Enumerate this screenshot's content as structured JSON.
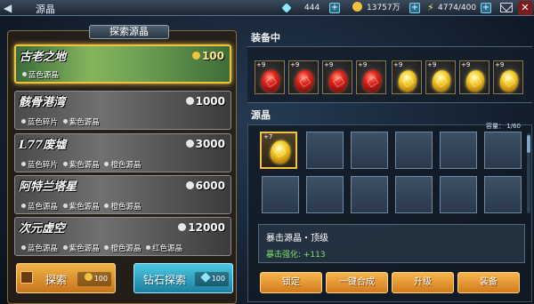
{
  "topbar": {
    "title": "源晶",
    "diamonds": "444",
    "gold": "13757万",
    "energy": "4774/400",
    "back_icon": "arrow-left-icon",
    "mail_icon": "mail-icon",
    "close_icon": "close-icon"
  },
  "explore": {
    "header": "探索源晶",
    "areas": [
      {
        "name": "古老之地",
        "cost": "100",
        "drops": [
          "蓝色源晶"
        ],
        "active": true
      },
      {
        "name": "骸骨港湾",
        "cost": "1000",
        "drops": [
          "蓝色碎片",
          "紫色源晶"
        ],
        "active": false
      },
      {
        "name": "L77废墟",
        "cost": "3000",
        "drops": [
          "蓝色碎片",
          "紫色源晶",
          "橙色源晶"
        ],
        "active": false
      },
      {
        "name": "阿特兰塔星",
        "cost": "6000",
        "drops": [
          "蓝色源晶",
          "紫色源晶",
          "橙色源晶"
        ],
        "active": false
      },
      {
        "name": "次元虚空",
        "cost": "12000",
        "drops": [
          "蓝色源晶",
          "紫色源晶",
          "橙色源晶",
          "红色源晶"
        ],
        "active": false
      }
    ],
    "explore_button": {
      "label": "探索",
      "cost": "100"
    },
    "diamond_button": {
      "label": "钻石探索",
      "cost": "100"
    }
  },
  "equipped": {
    "title": "装备中",
    "slots": [
      {
        "level": "+9",
        "color": "red"
      },
      {
        "level": "+9",
        "color": "red"
      },
      {
        "level": "+9",
        "color": "red"
      },
      {
        "level": "+9",
        "color": "red"
      },
      {
        "level": "+9",
        "color": "gold"
      },
      {
        "level": "+9",
        "color": "gold"
      },
      {
        "level": "+9",
        "color": "gold"
      },
      {
        "level": "+9",
        "color": "gold"
      }
    ]
  },
  "crystals": {
    "title": "源晶",
    "capacity": "容量： 1/60",
    "items": [
      {
        "level": "+7",
        "color": "gold",
        "selected": true
      }
    ],
    "empty_cells": 11
  },
  "detail": {
    "name": "暴击源晶・顶级",
    "stat": "暴击强化: +113"
  },
  "actions": [
    "锁定",
    "一键合成",
    "升级",
    "装备"
  ],
  "colors": {
    "accent_gold": "#f5c242",
    "stat_green": "#7be36a",
    "button_orange": "#e08a28",
    "button_cyan": "#2fa8c8"
  }
}
